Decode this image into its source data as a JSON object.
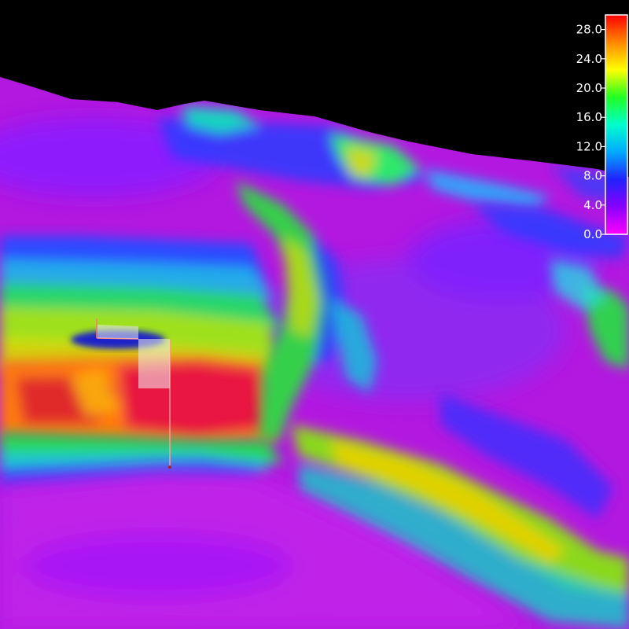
{
  "colorbar": {
    "ticks": [
      "0.0",
      "4.0",
      "8.0",
      "12.0",
      "16.0",
      "20.0",
      "24.0",
      "28.0"
    ],
    "min": 0,
    "max": 30,
    "colors": [
      "#ff00ff",
      "#8800ff",
      "#2222ff",
      "#00aaff",
      "#00ffcc",
      "#22ff22",
      "#ffff00",
      "#ff8800",
      "#ff0000"
    ]
  },
  "scene": {
    "background": "#000000",
    "markers": [
      "flag-marker",
      "flag-marker"
    ]
  }
}
